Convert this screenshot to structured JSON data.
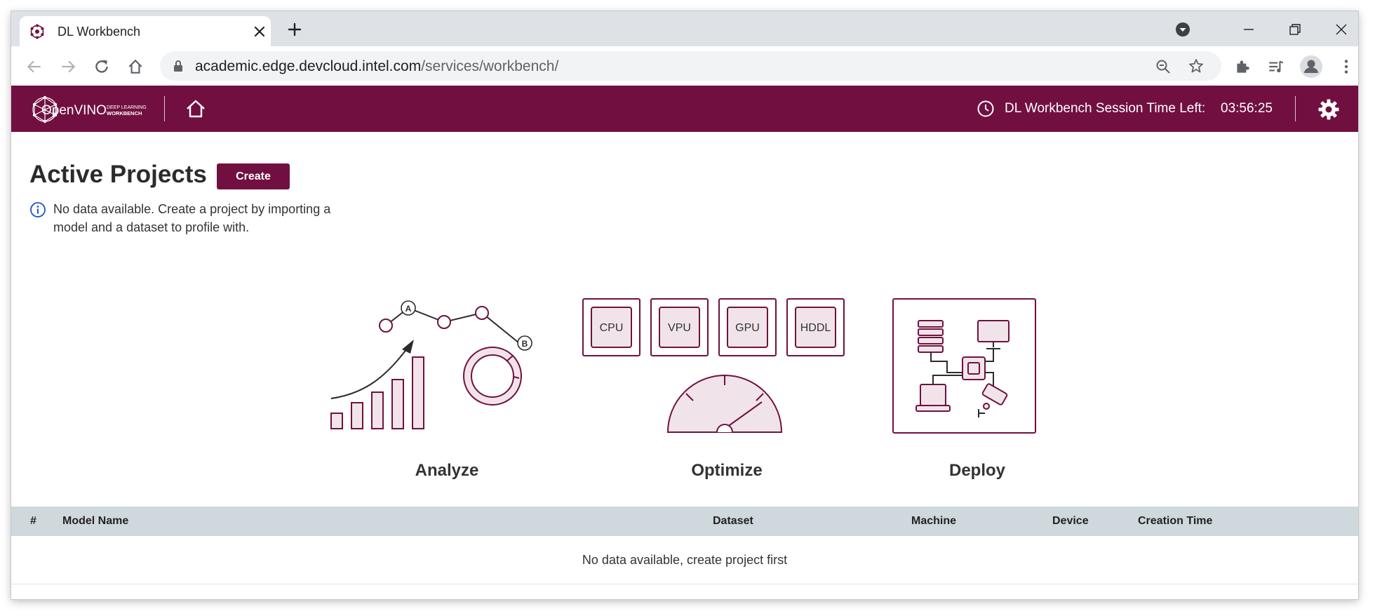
{
  "browser": {
    "tab_title": "DL Workbench",
    "url_host": "academic.edge.devcloud.intel.com",
    "url_path": "/services/workbench/"
  },
  "header": {
    "logo_text": "OpenVINO",
    "logo_subtext_1": "DEEP LEARNING",
    "logo_subtext_2": "WORKBENCH",
    "session_label": "DL Workbench Session Time Left:",
    "session_time": "03:56:25"
  },
  "main": {
    "title": "Active Projects",
    "create_label": "Create",
    "info_text": "No data available. Create a project by importing a model and a dataset to profile with."
  },
  "features": [
    {
      "label": "Analyze",
      "chart_points": [
        "A",
        "B"
      ]
    },
    {
      "label": "Optimize",
      "devices": [
        "CPU",
        "VPU",
        "GPU",
        "HDDL"
      ]
    },
    {
      "label": "Deploy"
    }
  ],
  "table": {
    "columns": [
      "#",
      "Model Name",
      "Dataset",
      "Machine",
      "Device",
      "Creation Time"
    ],
    "empty_text": "No data available, create project first"
  },
  "colors": {
    "brand": "#711040",
    "tab_strip": "#dee1e6",
    "table_header": "#cfd8dc",
    "illustration_fill": "#f0e4ea"
  }
}
